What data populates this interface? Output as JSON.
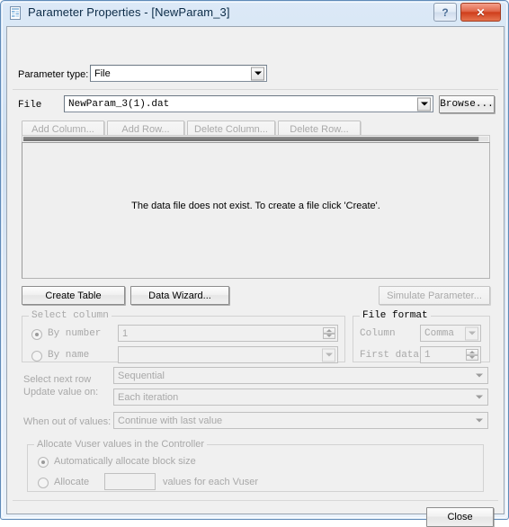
{
  "window": {
    "title": "Parameter Properties - [NewParam_3]",
    "icon": "parameter-table-icon",
    "help_label": "?",
    "close_label": "✕"
  },
  "parameter_type": {
    "label": "Parameter type:",
    "value": "File"
  },
  "file_row": {
    "label": "File",
    "value": "NewParam_3(1).dat",
    "browse_label": "Browse..."
  },
  "table_buttons": [
    {
      "label": "Add Column...",
      "enabled": false
    },
    {
      "label": "Add Row...",
      "enabled": false
    },
    {
      "label": "Delete Column...",
      "enabled": false
    },
    {
      "label": "Delete Row...",
      "enabled": false
    }
  ],
  "data_pane": {
    "message": "The data file does not exist. To create a file click 'Create'."
  },
  "action_buttons": {
    "create_table": "Create Table",
    "data_wizard": "Data Wizard...",
    "simulate_parameter": "Simulate Parameter..."
  },
  "select_column": {
    "caption": "Select column",
    "by_number_label": "By number",
    "by_number_value": "1",
    "by_name_label": "By name",
    "by_name_value": "",
    "selected": "by_number"
  },
  "file_format": {
    "caption": "File format",
    "column_label": "Column",
    "column_value": "Comma",
    "first_data_label": "First data",
    "first_data_value": "1"
  },
  "row_options": {
    "select_next_row_label": "Select next row",
    "select_next_row_value": "Sequential",
    "update_value_on_label": "Update value on:",
    "update_value_on_value": "Each iteration",
    "when_out_of_values_label": "When out of values:",
    "when_out_of_values_value": "Continue with last value"
  },
  "allocate": {
    "caption": "Allocate Vuser values in the Controller",
    "auto_label": "Automatically allocate block size",
    "allocate_label": "Allocate",
    "allocate_value": "",
    "allocate_suffix": "values for each Vuser",
    "selected": "auto"
  },
  "footer": {
    "close_label": "Close"
  },
  "colors": {
    "dialog_background": "#f0f0f0",
    "frame_blue": "#5f8ab8",
    "close_red": "#cf3d1b",
    "disabled_text": "#a8a8a8"
  }
}
